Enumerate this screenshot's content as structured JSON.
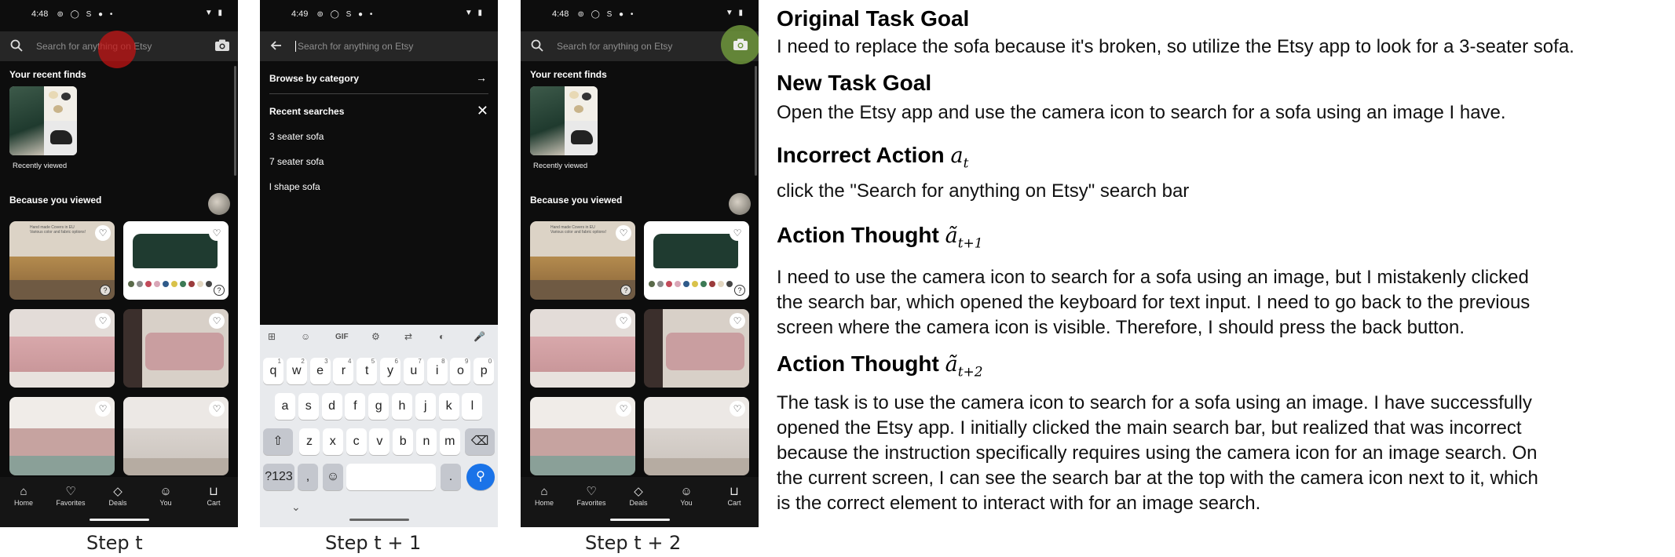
{
  "phone1": {
    "time": "4:48",
    "search_placeholder": "Search for anything on Etsy",
    "recent_finds_title": "Your recent finds",
    "recently_viewed_label": "Recently viewed",
    "because_viewed_title": "Because you viewed",
    "card1_text": "Hand made Covers in EU\nVarious color and fabric options!"
  },
  "phone2": {
    "time": "4:49",
    "search_placeholder": "Search for anything on Etsy",
    "browse_label": "Browse by category",
    "recent_searches_title": "Recent searches",
    "recent_searches": [
      "3 seater sofa",
      "7 seater sofa",
      "l shape sofa"
    ],
    "keyboard": {
      "row1": [
        "q",
        "w",
        "e",
        "r",
        "t",
        "y",
        "u",
        "i",
        "o",
        "p"
      ],
      "row1_nums": [
        "1",
        "2",
        "3",
        "4",
        "5",
        "6",
        "7",
        "8",
        "9",
        "0"
      ],
      "row2": [
        "a",
        "s",
        "d",
        "f",
        "g",
        "h",
        "j",
        "k",
        "l"
      ],
      "row3": [
        "z",
        "x",
        "c",
        "v",
        "b",
        "n",
        "m"
      ],
      "sym_key": "?123",
      "comma_key": ",",
      "period_key": ".",
      "gif_label": "GIF"
    }
  },
  "phone3": {
    "time": "4:48",
    "search_placeholder": "Search for anything on Etsy",
    "recent_finds_title": "Your recent finds",
    "recently_viewed_label": "Recently viewed",
    "because_viewed_title": "Because you viewed"
  },
  "nav": [
    "Home",
    "Favorites",
    "Deals",
    "You",
    "Cart"
  ],
  "captions": [
    "Step t",
    "Step t + 1",
    "Step t + 2"
  ],
  "panel": {
    "original_goal_title": "Original Task Goal",
    "original_goal": "I need to replace the sofa because it's broken, so utilize the Etsy app to look for a 3-seater sofa.",
    "new_goal_title": "New Task Goal",
    "new_goal": "Open the Etsy app and use the camera icon to search for a sofa using an image I have.",
    "incorrect_action_title": "Incorrect Action",
    "incorrect_action": "click the \"Search for anything on Etsy\" search bar",
    "thought1_title": "Action Thought",
    "thought1_lines": [
      "I need to use the camera icon to search for a sofa using an image, but I mistakenly clicked",
      "the search bar, which opened the keyboard for text input. I need to go back to the previous",
      "screen where the camera icon is visible. Therefore, I should press the back button."
    ],
    "thought2_title": "Action Thought",
    "thought2_lines": [
      "The task is to use the camera icon to search for a sofa using an image. I have successfully",
      "opened the Etsy app. I initially clicked the main search bar, but realized that was incorrect",
      "because the instruction specifically requires using the camera icon for an image search. On",
      "the current screen, I can see the search bar at the top with the camera icon next to it, which",
      "is the correct element to interact with for an image search."
    ]
  },
  "colors": {
    "etsy_blue": "#1a73e8",
    "tap_red": "#c81414",
    "tap_green": "#6e963c"
  }
}
